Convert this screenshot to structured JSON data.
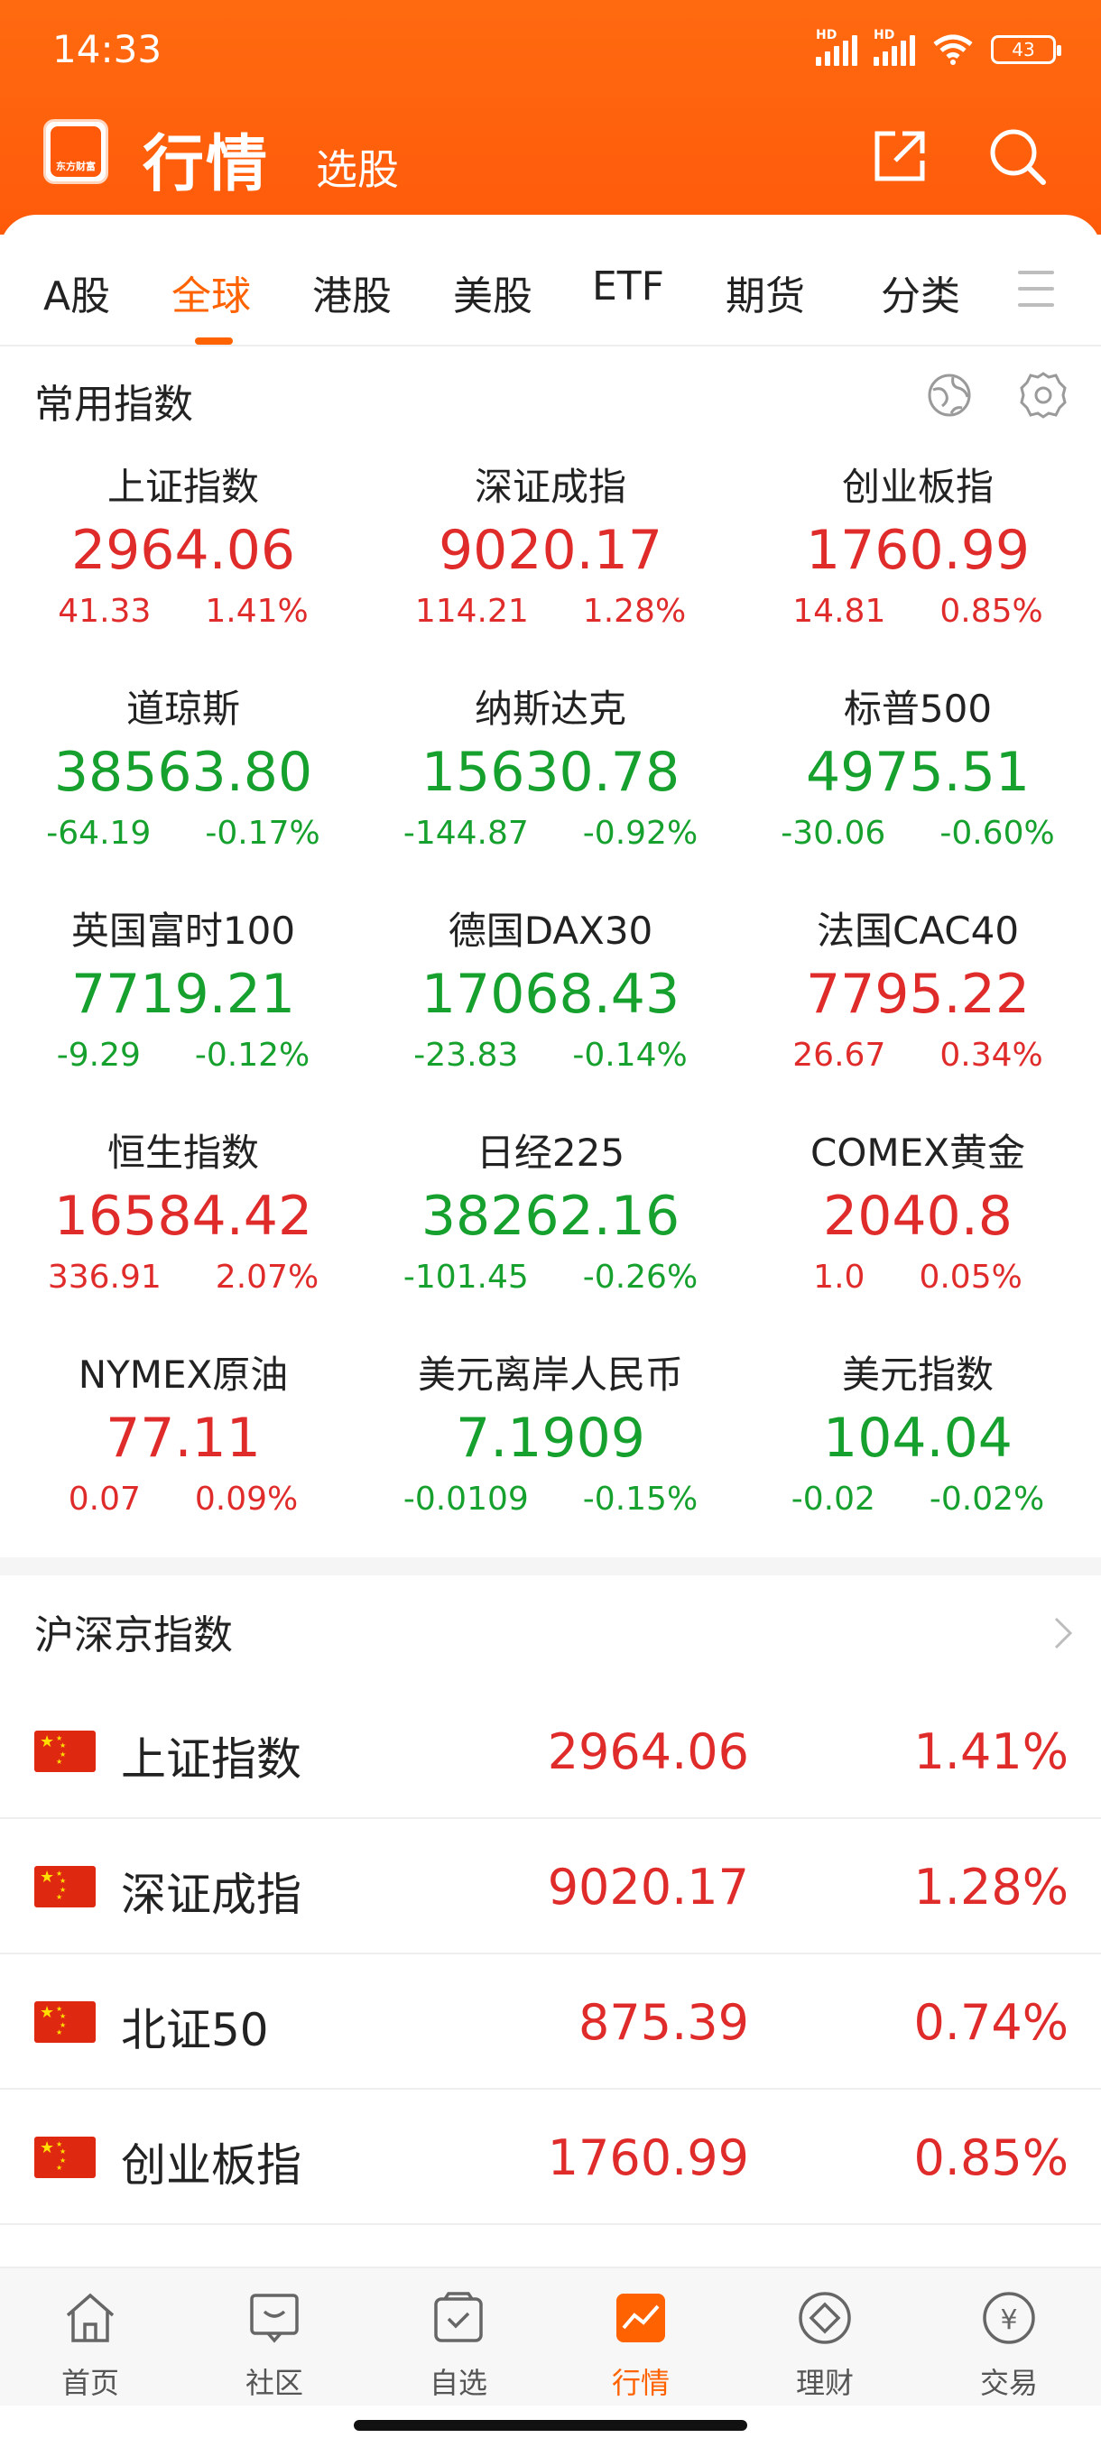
{
  "status_bar": {
    "time": "14:33",
    "battery": "43",
    "hd": "HD"
  },
  "header": {
    "logo_text": "东方财富",
    "title": "行情",
    "subtitle": "选股"
  },
  "tabs": [
    {
      "label": "A股",
      "active": false
    },
    {
      "label": "全球",
      "active": true
    },
    {
      "label": "港股",
      "active": false
    },
    {
      "label": "美股",
      "active": false
    },
    {
      "label": "ETF",
      "active": false
    },
    {
      "label": "期货",
      "active": false
    },
    {
      "label": "分类",
      "active": false
    }
  ],
  "common_indices": {
    "title": "常用指数",
    "items": [
      {
        "name": "上证指数",
        "price": "2964.06",
        "change": "41.33",
        "pct": "1.41%",
        "dir": "up"
      },
      {
        "name": "深证成指",
        "price": "9020.17",
        "change": "114.21",
        "pct": "1.28%",
        "dir": "up"
      },
      {
        "name": "创业板指",
        "price": "1760.99",
        "change": "14.81",
        "pct": "0.85%",
        "dir": "up"
      },
      {
        "name": "道琼斯",
        "price": "38563.80",
        "change": "-64.19",
        "pct": "-0.17%",
        "dir": "down"
      },
      {
        "name": "纳斯达克",
        "price": "15630.78",
        "change": "-144.87",
        "pct": "-0.92%",
        "dir": "down"
      },
      {
        "name": "标普500",
        "price": "4975.51",
        "change": "-30.06",
        "pct": "-0.60%",
        "dir": "down"
      },
      {
        "name": "英国富时100",
        "price": "7719.21",
        "change": "-9.29",
        "pct": "-0.12%",
        "dir": "down"
      },
      {
        "name": "德国DAX30",
        "price": "17068.43",
        "change": "-23.83",
        "pct": "-0.14%",
        "dir": "down"
      },
      {
        "name": "法国CAC40",
        "price": "7795.22",
        "change": "26.67",
        "pct": "0.34%",
        "dir": "up"
      },
      {
        "name": "恒生指数",
        "price": "16584.42",
        "change": "336.91",
        "pct": "2.07%",
        "dir": "up"
      },
      {
        "name": "日经225",
        "price": "38262.16",
        "change": "-101.45",
        "pct": "-0.26%",
        "dir": "down"
      },
      {
        "name": "COMEX黄金",
        "price": "2040.8",
        "change": "1.0",
        "pct": "0.05%",
        "dir": "up"
      },
      {
        "name": "NYMEX原油",
        "price": "77.11",
        "change": "0.07",
        "pct": "0.09%",
        "dir": "up"
      },
      {
        "name": "美元离岸人民币",
        "price": "7.1909",
        "change": "-0.0109",
        "pct": "-0.15%",
        "dir": "down"
      },
      {
        "name": "美元指数",
        "price": "104.04",
        "change": "-0.02",
        "pct": "-0.02%",
        "dir": "down"
      }
    ]
  },
  "hs_indices": {
    "title": "沪深京指数",
    "rows": [
      {
        "name": "上证指数",
        "price": "2964.06",
        "pct": "1.41%"
      },
      {
        "name": "深证成指",
        "price": "9020.17",
        "pct": "1.28%"
      },
      {
        "name": "北证50",
        "price": "875.39",
        "pct": "0.74%"
      },
      {
        "name": "创业板指",
        "price": "1760.99",
        "pct": "0.85%"
      }
    ]
  },
  "bottom_nav": [
    {
      "label": "首页",
      "icon": "home-icon",
      "active": false
    },
    {
      "label": "社区",
      "icon": "community-icon",
      "active": false
    },
    {
      "label": "自选",
      "icon": "watchlist-icon",
      "active": false
    },
    {
      "label": "行情",
      "icon": "market-icon",
      "active": true
    },
    {
      "label": "理财",
      "icon": "wealth-icon",
      "active": false
    },
    {
      "label": "交易",
      "icon": "trade-icon",
      "active": false
    }
  ],
  "colors": {
    "brand": "#ff6200",
    "up": "#e02b2b",
    "down": "#16a02d"
  }
}
